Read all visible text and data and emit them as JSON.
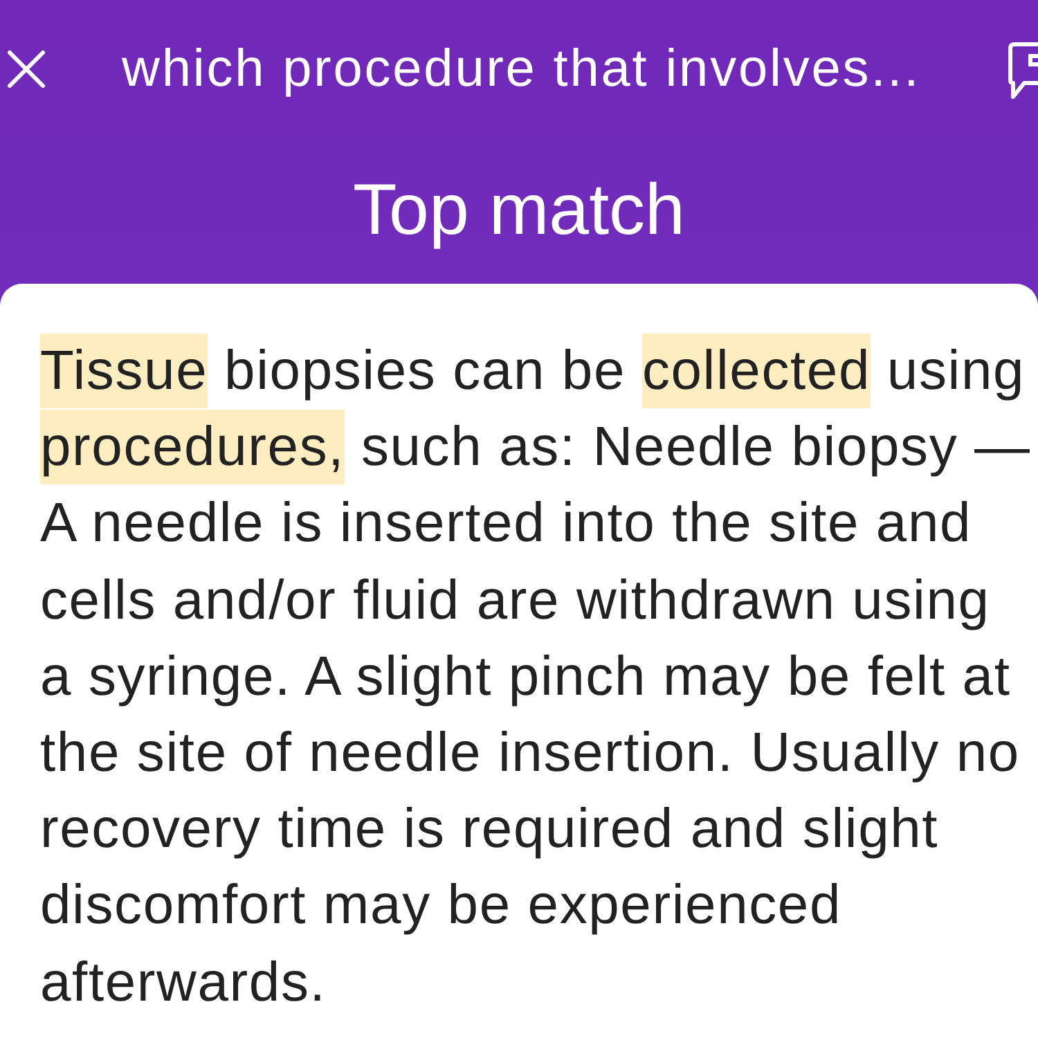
{
  "header": {
    "query": "which procedure that involves...",
    "title": "Top match"
  },
  "answer": {
    "segments": [
      {
        "text": "Tissue",
        "highlighted": true
      },
      {
        "text": " biopsies can be ",
        "highlighted": false
      },
      {
        "text": "collected",
        "highlighted": true
      },
      {
        "text": " using ",
        "highlighted": false
      },
      {
        "text": "procedures,",
        "highlighted": true
      },
      {
        "text": " such as: Needle biopsy — A needle is inserted into the site and cells and/or fluid are withdrawn using a syringe. A slight pinch may be felt at the site of needle insertion. Usually no recovery time is required and slight discomfort may be experienced afterwards.",
        "highlighted": false
      }
    ]
  }
}
